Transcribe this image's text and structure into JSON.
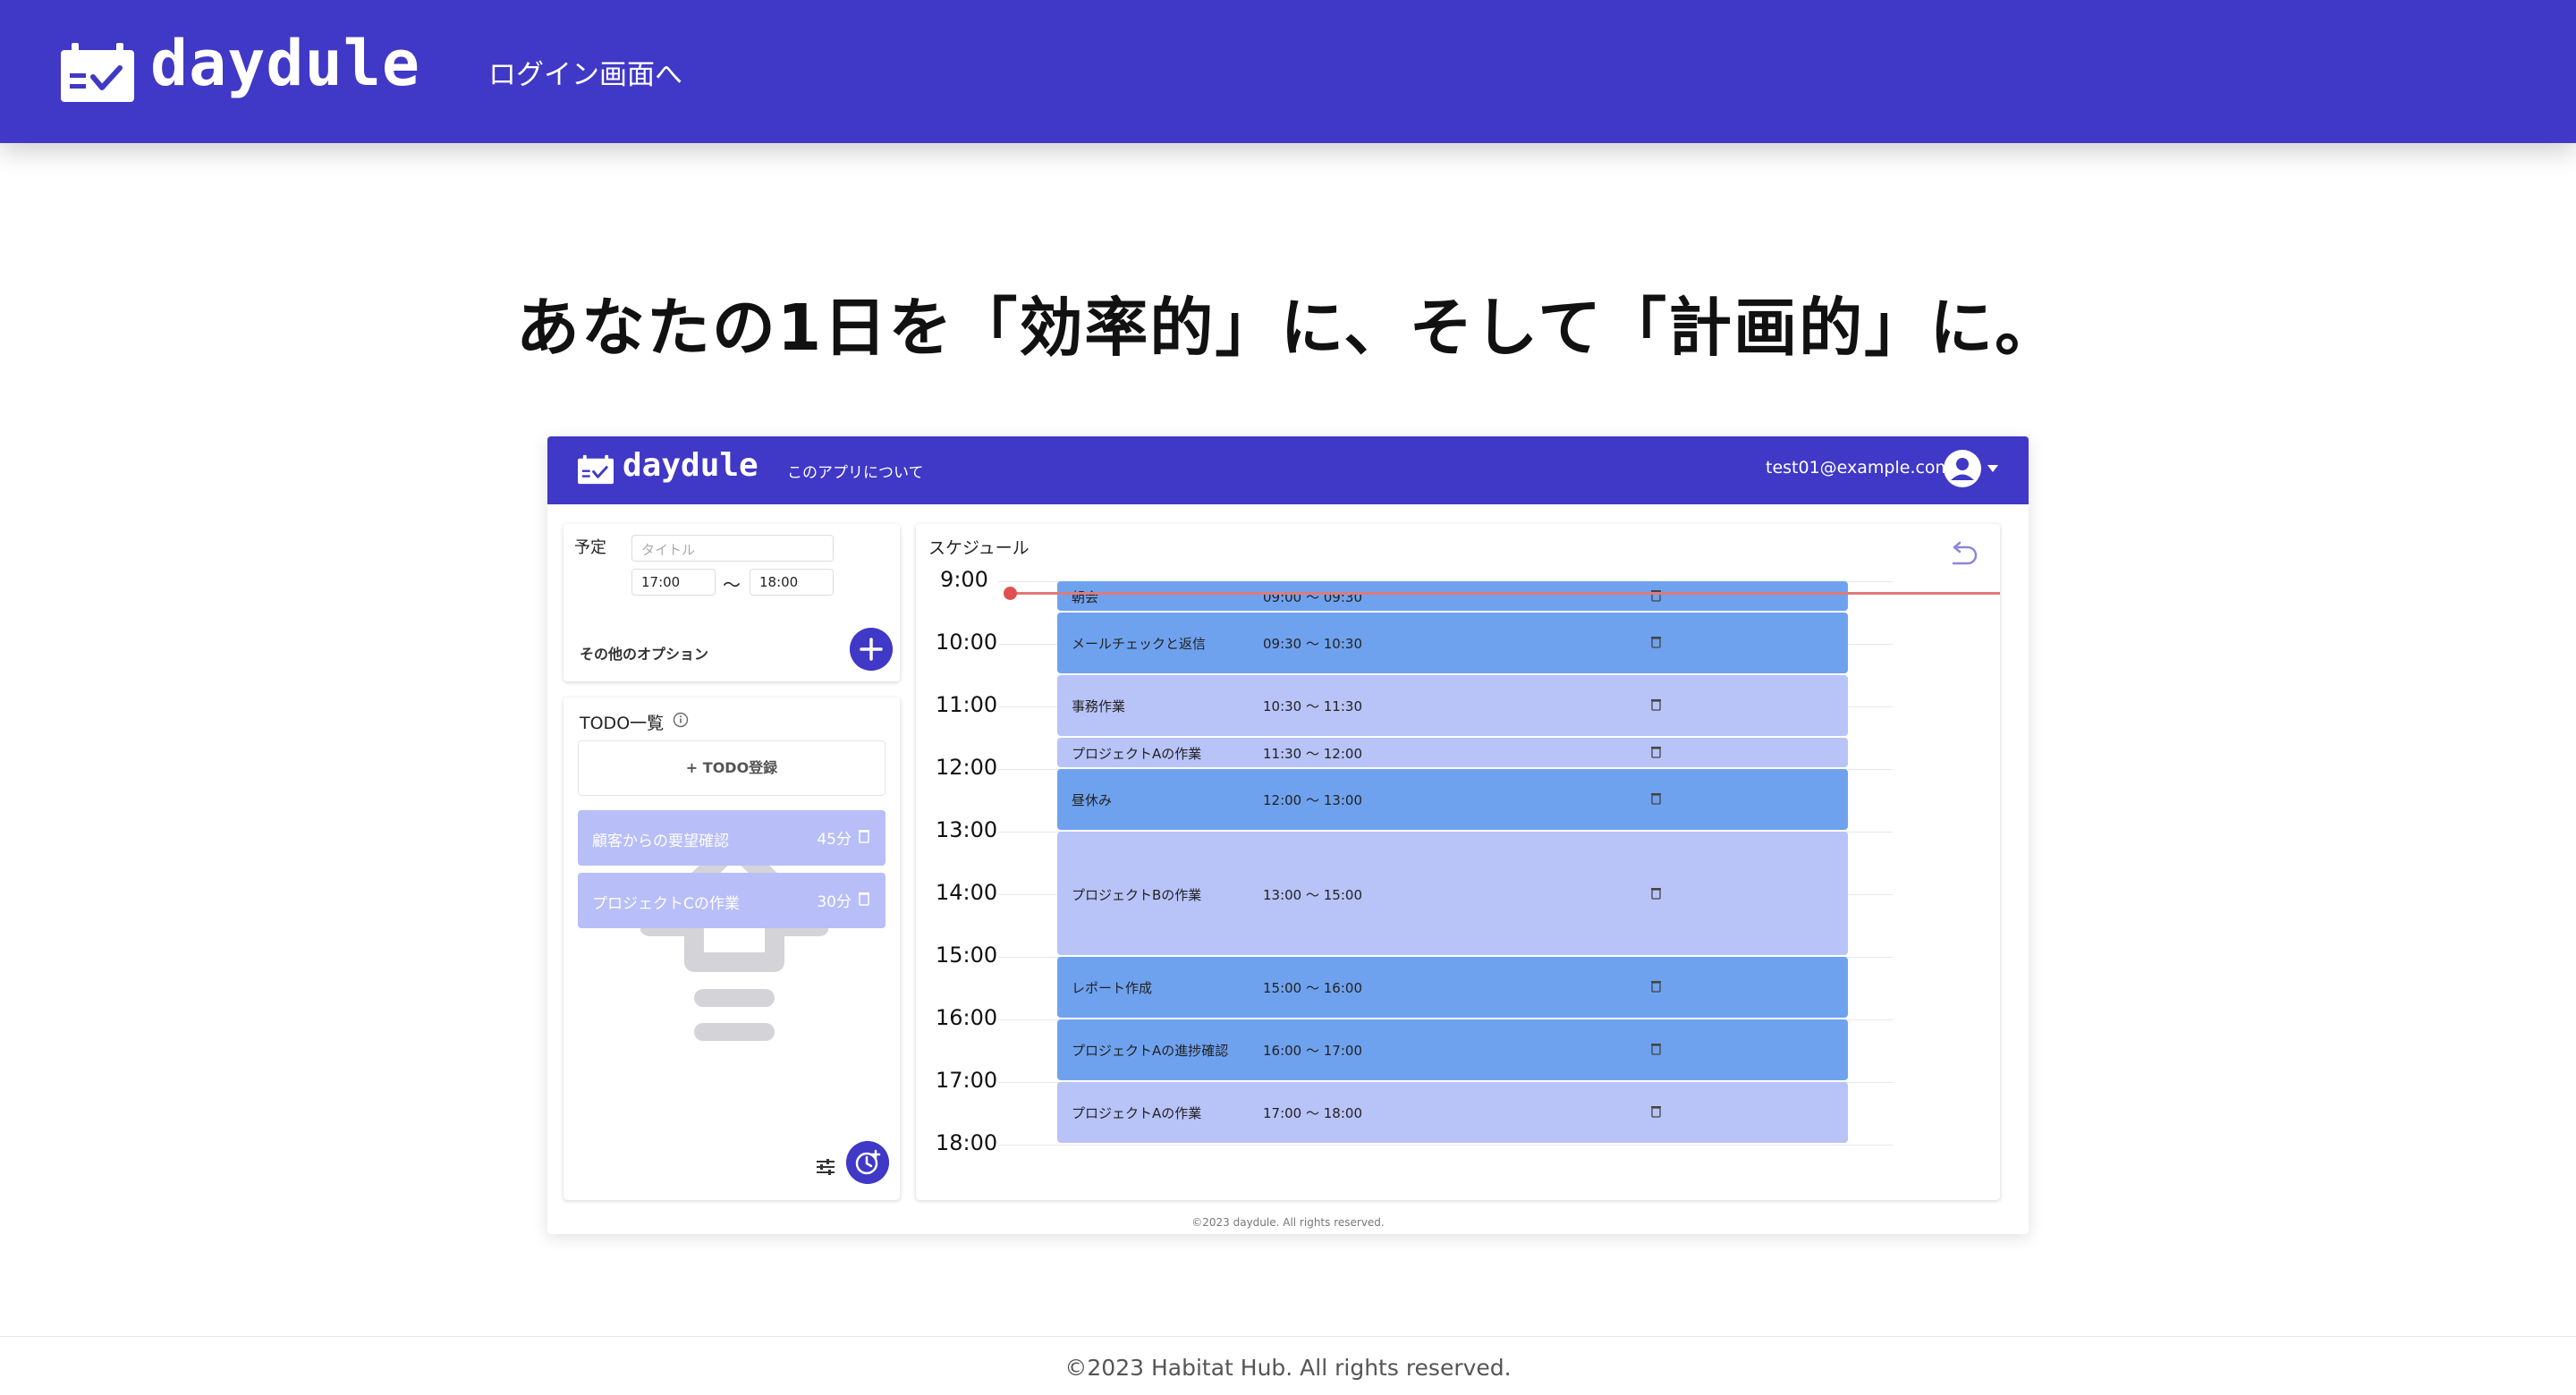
{
  "navbar": {
    "brand": "daydule",
    "login_link": "ログイン画面へ",
    "logo_icon": "calendar-check-icon",
    "background_color": "#4038c6"
  },
  "headline": "あなたの1日を「効率的」に、そして「計画的」に。",
  "preview": {
    "navbar": {
      "brand": "daydule",
      "about_link": "このアプリについて",
      "user_email": "test01@example.com",
      "avatar_icon": "user-circle-icon"
    },
    "event_form": {
      "label": "予定",
      "title_placeholder": "タイトル",
      "start_time": "17:00",
      "separator": "〜",
      "end_time": "18:00",
      "more_options": "その他のオプション",
      "add_icon": "plus-icon"
    },
    "todo": {
      "title": "TODO一覧",
      "info_icon": "info-icon",
      "register_button": "+ TODO登録",
      "items": [
        {
          "name": "顧客からの要望確認",
          "duration": "45分"
        },
        {
          "name": "プロジェクトCの作業",
          "duration": "30分"
        }
      ],
      "filter_icon": "sliders-icon",
      "clock_icon": "clock-plus-icon"
    },
    "schedule": {
      "title": "スケジュール",
      "undo_icon": "undo-icon",
      "hours": [
        "9:00",
        "10:00",
        "11:00",
        "12:00",
        "13:00",
        "14:00",
        "15:00",
        "16:00",
        "17:00",
        "18:00"
      ],
      "events": [
        {
          "name": "朝会",
          "time": "09:00 〜 09:30",
          "style": "dark"
        },
        {
          "name": "メールチェックと返信",
          "time": "09:30 〜 10:30",
          "style": "dark"
        },
        {
          "name": "事務作業",
          "time": "10:30 〜 11:30",
          "style": "light"
        },
        {
          "name": "プロジェクトAの作業",
          "time": "11:30 〜 12:00",
          "style": "light"
        },
        {
          "name": "昼休み",
          "time": "12:00 〜 13:00",
          "style": "dark"
        },
        {
          "name": "プロジェクトBの作業",
          "time": "13:00 〜 15:00",
          "style": "light"
        },
        {
          "name": "レポート作成",
          "time": "15:00 〜 16:00",
          "style": "dark"
        },
        {
          "name": "プロジェクトAの進捗確認",
          "time": "16:00 〜 17:00",
          "style": "dark"
        },
        {
          "name": "プロジェクトAの作業",
          "time": "17:00 〜 18:00",
          "style": "light"
        }
      ]
    },
    "footer": "©2023 daydule. All rights reserved."
  },
  "footer": "©2023 Habitat Hub. All rights reserved."
}
